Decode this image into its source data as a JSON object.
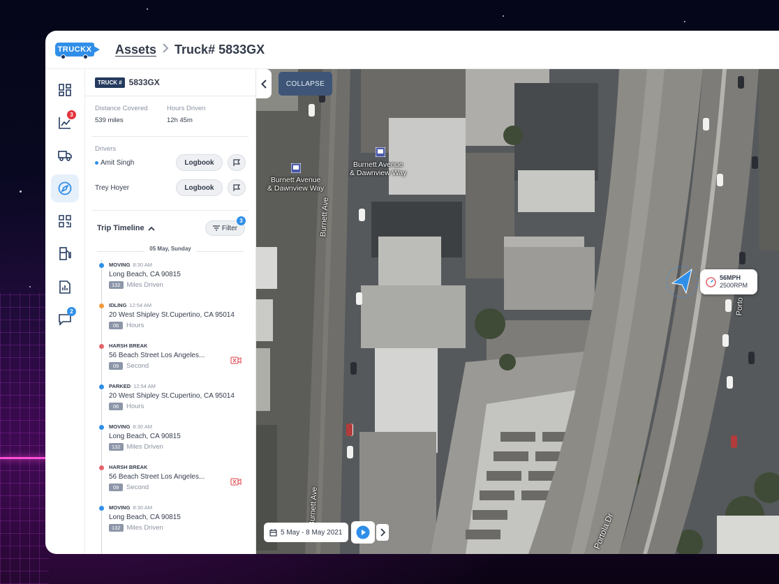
{
  "app": {
    "logo_text": "TRUCKX"
  },
  "breadcrumb": {
    "parent": "Assets",
    "separator": ">",
    "current": "Truck# 5833GX"
  },
  "nav": {
    "items": [
      {
        "name": "dashboard",
        "icon": "dashboard-icon"
      },
      {
        "name": "analytics",
        "icon": "chart-icon",
        "badge": "3",
        "badge_color": "#e5323b"
      },
      {
        "name": "trucks",
        "icon": "truck-icon"
      },
      {
        "name": "navigation",
        "icon": "compass-icon",
        "active": true
      },
      {
        "name": "qr",
        "icon": "qr-icon"
      },
      {
        "name": "fuel",
        "icon": "fuel-icon"
      },
      {
        "name": "reports",
        "icon": "report-icon"
      },
      {
        "name": "messages",
        "icon": "chat-icon",
        "badge": "2",
        "badge_color": "#2f8fe8"
      }
    ]
  },
  "panel": {
    "truck_tag": "TRUCK #",
    "truck_id": "5833GX",
    "stats": [
      {
        "label": "Distance Covered",
        "value": "539 miles"
      },
      {
        "label": "Hours Driven",
        "value": "12h 45m"
      }
    ],
    "drivers_label": "Drivers",
    "drivers": [
      {
        "name": "Amit Singh",
        "live": true,
        "logbook_label": "Logbook"
      },
      {
        "name": "Trey Hoyer",
        "live": false,
        "logbook_label": "Logbook"
      }
    ],
    "timeline": {
      "title": "Trip Timeline",
      "filter_label": "Filter",
      "filter_count": "3",
      "date": "05 May, Sunday",
      "events": [
        {
          "type": "MOVING",
          "time": "8:30 AM",
          "address": "Long Beach, CA 90815",
          "value": "132",
          "unit": "Miles Driven",
          "color": "#2f8fe8",
          "camera": false
        },
        {
          "type": "IDLING",
          "time": "12:54 AM",
          "address": "20 West Shipley St.Cupertino, CA 95014",
          "value": "06",
          "unit": "Hours",
          "color": "#f09a3e",
          "camera": false
        },
        {
          "type": "HARSH BREAK",
          "time": "",
          "address": "56 Beach Street Los Angeles...",
          "value": "09",
          "unit": "Second",
          "color": "#e5646b",
          "camera": true
        },
        {
          "type": "PARKED",
          "time": "12:54 AM",
          "address": "20 West Shipley St.Cupertino, CA 95014",
          "value": "06",
          "unit": "Hours",
          "color": "#2f8fe8",
          "camera": false
        },
        {
          "type": "MOVING",
          "time": "8:30 AM",
          "address": "Long Beach, CA 90815",
          "value": "132",
          "unit": "Miles Driven",
          "color": "#2f8fe8",
          "camera": false
        },
        {
          "type": "HARSH BREAK",
          "time": "",
          "address": "56 Beach Street Los Angeles...",
          "value": "09",
          "unit": "Second",
          "color": "#e5646b",
          "camera": true
        },
        {
          "type": "MOVING",
          "time": "8:30 AM",
          "address": "Long Beach, CA 90815",
          "value": "132",
          "unit": "Miles Driven",
          "color": "#2f8fe8",
          "camera": false
        }
      ]
    }
  },
  "map": {
    "collapse_label": "COLLAPSE",
    "labels": {
      "bus_stop_1": "Burnett Avenue\n& Dawnview Way",
      "bus_stop_2": "Burnett Avenue\n& Dawnview Way",
      "street_1": "Burnett Ave",
      "street_2": "Burnett Ave",
      "street_3": "Portola Dr",
      "street_4": "Porto"
    },
    "speed": "56MPH",
    "rpm": "2500RPM",
    "date_range": "5 May - 8 May 2021"
  },
  "colors": {
    "accent": "#2f8fe8",
    "navy": "#243a5e",
    "alert": "#e5323b"
  }
}
